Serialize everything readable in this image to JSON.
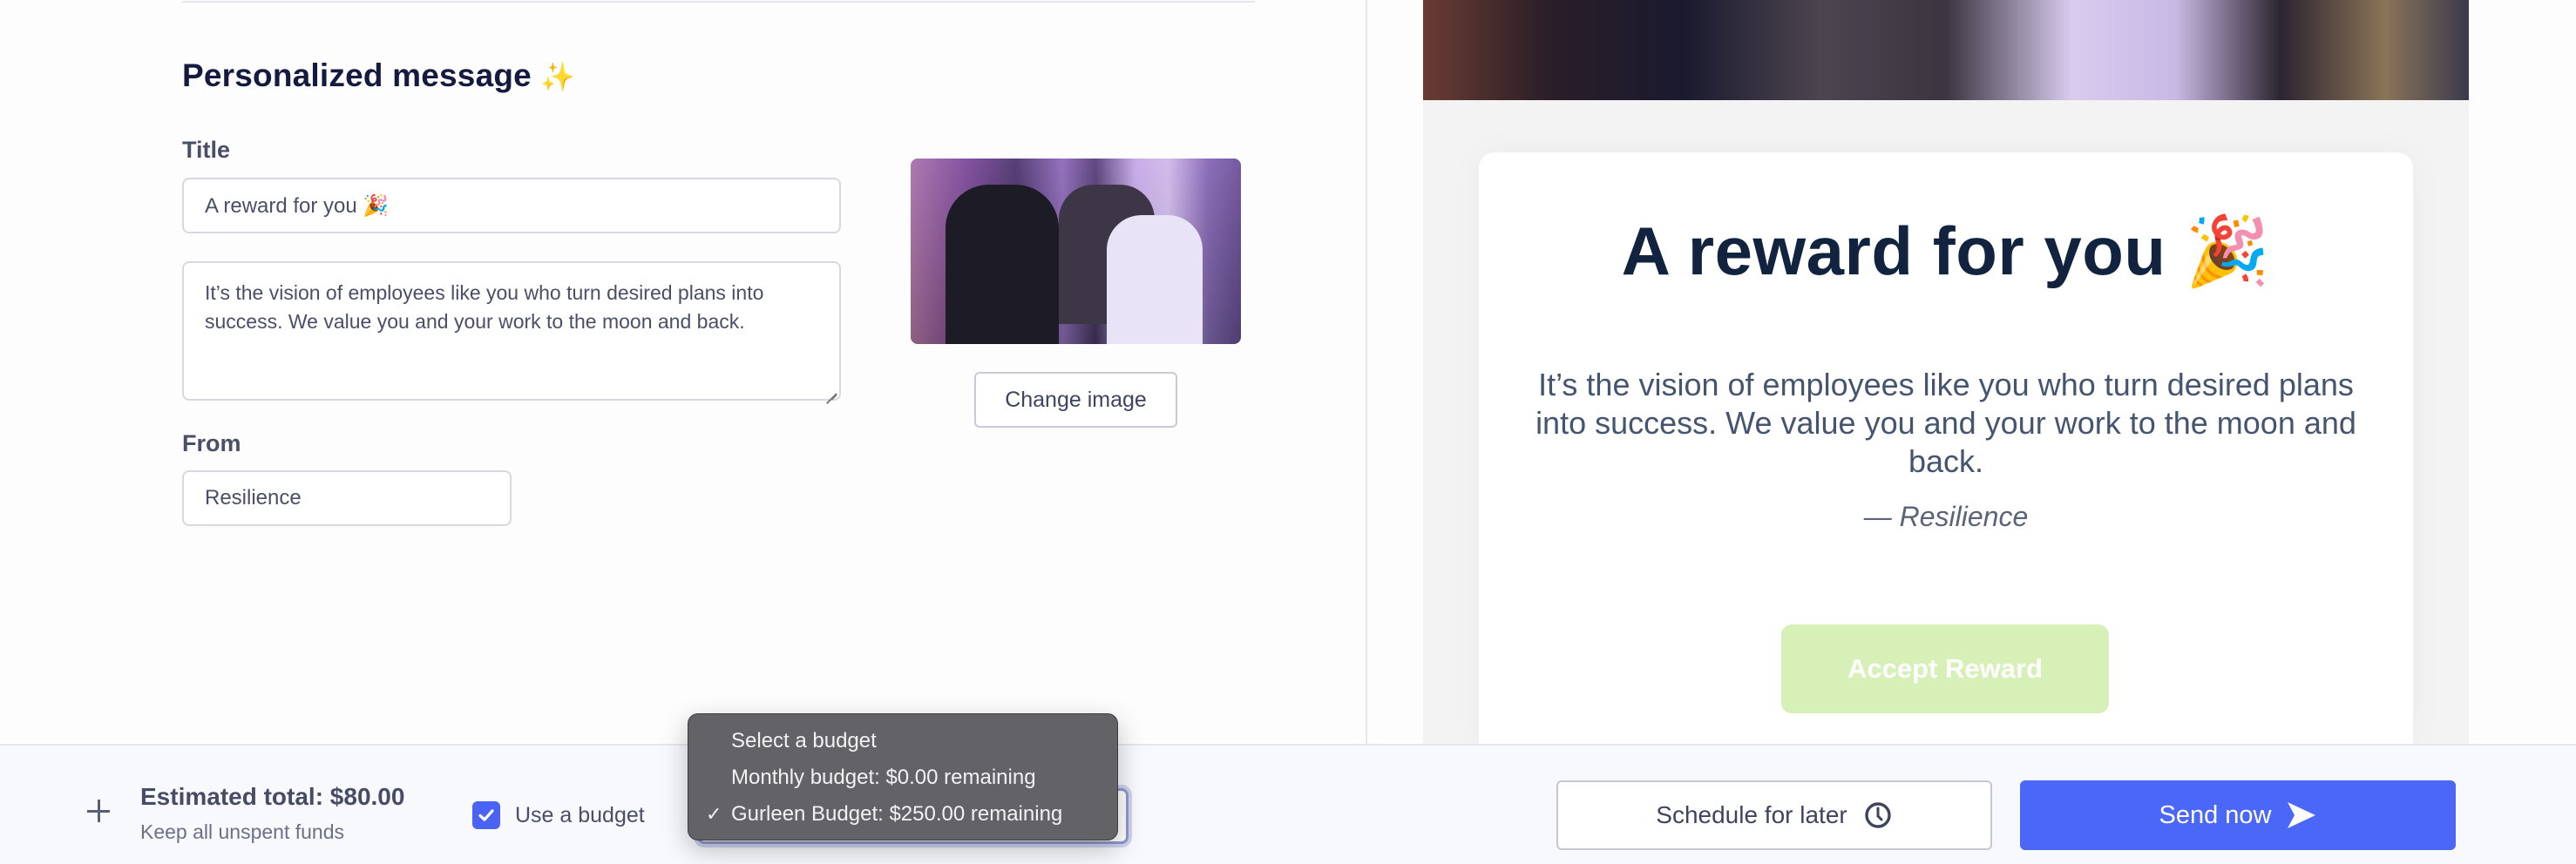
{
  "editor": {
    "section_title": "Personalized message",
    "section_title_emoji": "✨",
    "title_label": "Title",
    "title_value": "A reward for you 🎉",
    "message_value": "It’s the vision of employees like you who turn desired plans into success. We value you and your work to the moon and back.",
    "from_label": "From",
    "from_value": "Resilience",
    "change_image_label": "Change image",
    "image_alt": "Dancing office coworkers GIF"
  },
  "preview": {
    "title": "A reward for you 🎉",
    "body": "It’s the vision of employees like you who turn desired plans into success. We value you and your work to the moon and back.",
    "from_line": "— Resilience",
    "accept_label": "Accept Reward",
    "accept_color": "#d6f0b8"
  },
  "footer": {
    "estimated_total": "Estimated total: $80.00",
    "subtext": "Keep all unspent funds",
    "use_budget_label": "Use a budget",
    "use_budget_checked": true,
    "budget_dropdown": {
      "options": [
        {
          "label": "Select a budget",
          "selected": false
        },
        {
          "label": "Monthly budget: $0.00 remaining",
          "selected": false
        },
        {
          "label": "Gurleen Budget: $250.00 remaining",
          "selected": true
        }
      ],
      "check_glyph": "✓"
    },
    "schedule_label": "Schedule for later",
    "send_label": "Send now",
    "accent_color": "#4b67f8"
  }
}
